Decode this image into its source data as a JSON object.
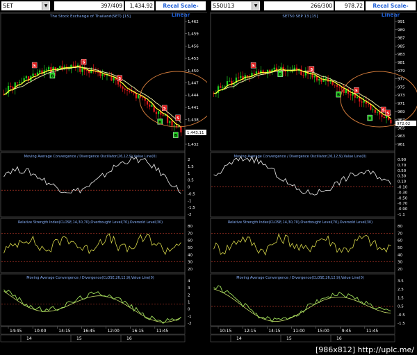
{
  "left": {
    "symbol": "SET",
    "counter": "397/409",
    "last_price": "1,434.92",
    "recal_label": "Recal Scale-Linear",
    "chart_title": "The Stock Exchange of Thailand(SET) [15]",
    "price_label": "1,443.11",
    "price_ticks": [
      "1,462",
      "1,459",
      "1,456",
      "1,453",
      "1,450",
      "1,447",
      "1,444",
      "1,441",
      "1,438",
      "1,435",
      "1,432"
    ],
    "price_ticks_b": [
      "1,460",
      "1,458",
      "1,455",
      "1,452",
      "1,449",
      "1,446",
      "1,443",
      "1,440",
      "1,437",
      "1,434"
    ],
    "macd1_title": "Moving Average Convergence / Divergence Oscillator(26,12,9),Value Line(0)",
    "macd1_ticks": [
      "2",
      "1.5",
      "1",
      "0.5",
      "0",
      "-0.5",
      "-1",
      "-1.5",
      "-2"
    ],
    "rsi_title": "Relative Strength Index(CLOSE,14,30,70),Overbought Level(70),Oversold Level(30)",
    "rsi_ticks": [
      "80",
      "70",
      "60",
      "50",
      "40",
      "30",
      "20"
    ],
    "macd2_title": "Moving Average Convergence / Divergence(CLOSE,26,12,9),Value Line(0)",
    "macd2_ticks": [
      "4",
      "3",
      "2",
      "1",
      "0",
      "-1",
      "-2"
    ],
    "time_labels": [
      "14:45",
      "10:00",
      "14:15",
      "16:45",
      "12:00",
      "16:15",
      "11:45"
    ],
    "date_labels": [
      "14",
      "15",
      "16"
    ]
  },
  "right": {
    "symbol": "S50U13",
    "counter": "266/300",
    "last_price": "978.72",
    "recal_label": "Recal Scale-Linear",
    "chart_title": "SET50 SEP 13  [15]",
    "price_label": "972.02",
    "price_ticks": [
      "991",
      "989",
      "987",
      "985",
      "983",
      "981",
      "979",
      "977",
      "975",
      "973",
      "971",
      "969",
      "967",
      "965",
      "963",
      "961"
    ],
    "macd1_title": "Moving Average Convergence / Divergence Oscillator(26,12,9),Value Line(0)",
    "macd1_ticks": [
      "0.90",
      "0.70",
      "0.50",
      "0.30",
      "0.10",
      "-0.10",
      "-0.30",
      "-0.50",
      "-0.70",
      "-0.90",
      "-1.1"
    ],
    "rsi_title": "Relative Strength Index(CLOSE,14,30,70),Overbought Level(70),Oversold Level(30)",
    "rsi_ticks": [
      "80",
      "70",
      "60",
      "50",
      "40",
      "30",
      "20"
    ],
    "macd2_title": "Moving Average Convergence / Divergence(CLOSE,26,12,9),Value Line(0)",
    "macd2_ticks": [
      "3.5",
      "2.5",
      "1.5",
      "0.5",
      "-0.5",
      "-1.5"
    ],
    "time_labels": [
      "10:15",
      "12:15",
      "14:15",
      "11:00",
      "15:00",
      "9:45",
      "11:45"
    ],
    "date_labels": [
      "14",
      "15",
      "16"
    ]
  },
  "watermark": "[986x812] http://uplc.me/",
  "colors": {
    "up": "#1fd11f",
    "down": "#e01818",
    "ma1": "#ffff33",
    "ma2": "#e8e8a0",
    "grid": "#c0392b",
    "title": "#8ab4ff",
    "circle": "#d07a3a"
  }
}
